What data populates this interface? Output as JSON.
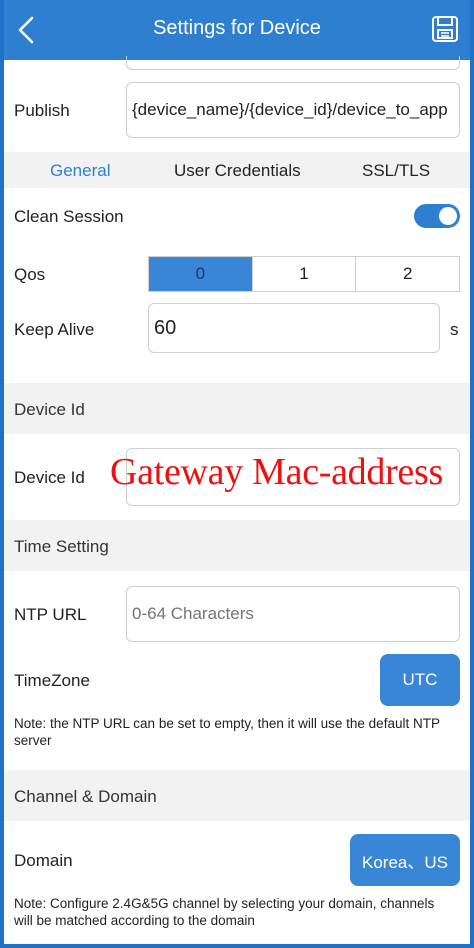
{
  "header": {
    "title": "Settings for Device"
  },
  "publish": {
    "label": "Publish",
    "value": "{device_name}/{device_id}/device_to_app"
  },
  "tabs": [
    {
      "label": "General",
      "active": true
    },
    {
      "label": "User Credentials",
      "active": false
    },
    {
      "label": "SSL/TLS",
      "active": false
    }
  ],
  "general": {
    "clean_session_label": "Clean Session",
    "clean_session_on": true,
    "qos_label": "Qos",
    "qos_options": [
      "0",
      "1",
      "2"
    ],
    "qos_selected": "0",
    "keep_alive_label": "Keep Alive",
    "keep_alive_value": "60",
    "keep_alive_unit": "s"
  },
  "device_id_section": {
    "title": "Device Id",
    "label": "Device Id",
    "overlay_text": "Gateway Mac-address"
  },
  "time_section": {
    "title": "Time Setting",
    "ntp_label": "NTP URL",
    "ntp_placeholder": "0-64 Characters",
    "timezone_label": "TimeZone",
    "timezone_value": "UTC",
    "note": "Note: the NTP URL can be set to empty, then it will use the default NTP server"
  },
  "channel_section": {
    "title": "Channel & Domain",
    "domain_label": "Domain",
    "domain_value": "Korea、US",
    "note": "Note: Configure 2.4G&5G channel by selecting your domain, channels will be matched according to the domain"
  },
  "colors": {
    "accent": "#2f7fd0",
    "button": "#3a86d6",
    "overlay_red": "#ee1111"
  }
}
